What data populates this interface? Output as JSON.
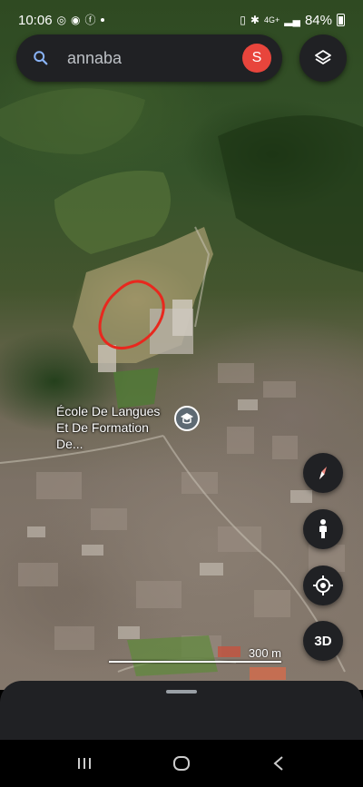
{
  "status_bar": {
    "time": "10:06",
    "network": "4G+",
    "battery": "84%"
  },
  "search": {
    "query": "annaba",
    "avatar_letter": "S"
  },
  "map": {
    "place_label": "École De Langues Et De Formation De...",
    "scale_label": "300 m",
    "highlight_color": "#e8281e"
  },
  "controls": {
    "three_d_label": "3D"
  },
  "icons": [
    "search-icon",
    "layers-icon",
    "compass-icon",
    "pegman-icon",
    "my-location-icon",
    "school-icon",
    "recents-icon",
    "home-icon",
    "back-icon"
  ]
}
